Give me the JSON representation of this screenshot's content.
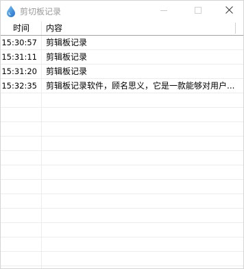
{
  "window": {
    "title": "剪切板记录",
    "icon": "water-drop-icon"
  },
  "controls": {
    "minimize_icon": "minimize-icon",
    "maximize_icon": "maximize-icon",
    "close_icon": "close-icon"
  },
  "table": {
    "columns": [
      "时间",
      "内容"
    ],
    "rows": [
      {
        "time": "15:30:57",
        "content": "剪辑板记录"
      },
      {
        "time": "15:31:11",
        "content": "剪辑板记录"
      },
      {
        "time": "15:31:20",
        "content": "剪辑板记录"
      },
      {
        "time": "15:32:35",
        "content": "剪辑板记录软件，顾名思义，它是一款能够对用户..."
      }
    ]
  },
  "colors": {
    "title_text": "#9a9a9a",
    "header_border": "#a0a0a0",
    "grid_line": "#ececec",
    "drop_icon": "#2f7fd6"
  }
}
